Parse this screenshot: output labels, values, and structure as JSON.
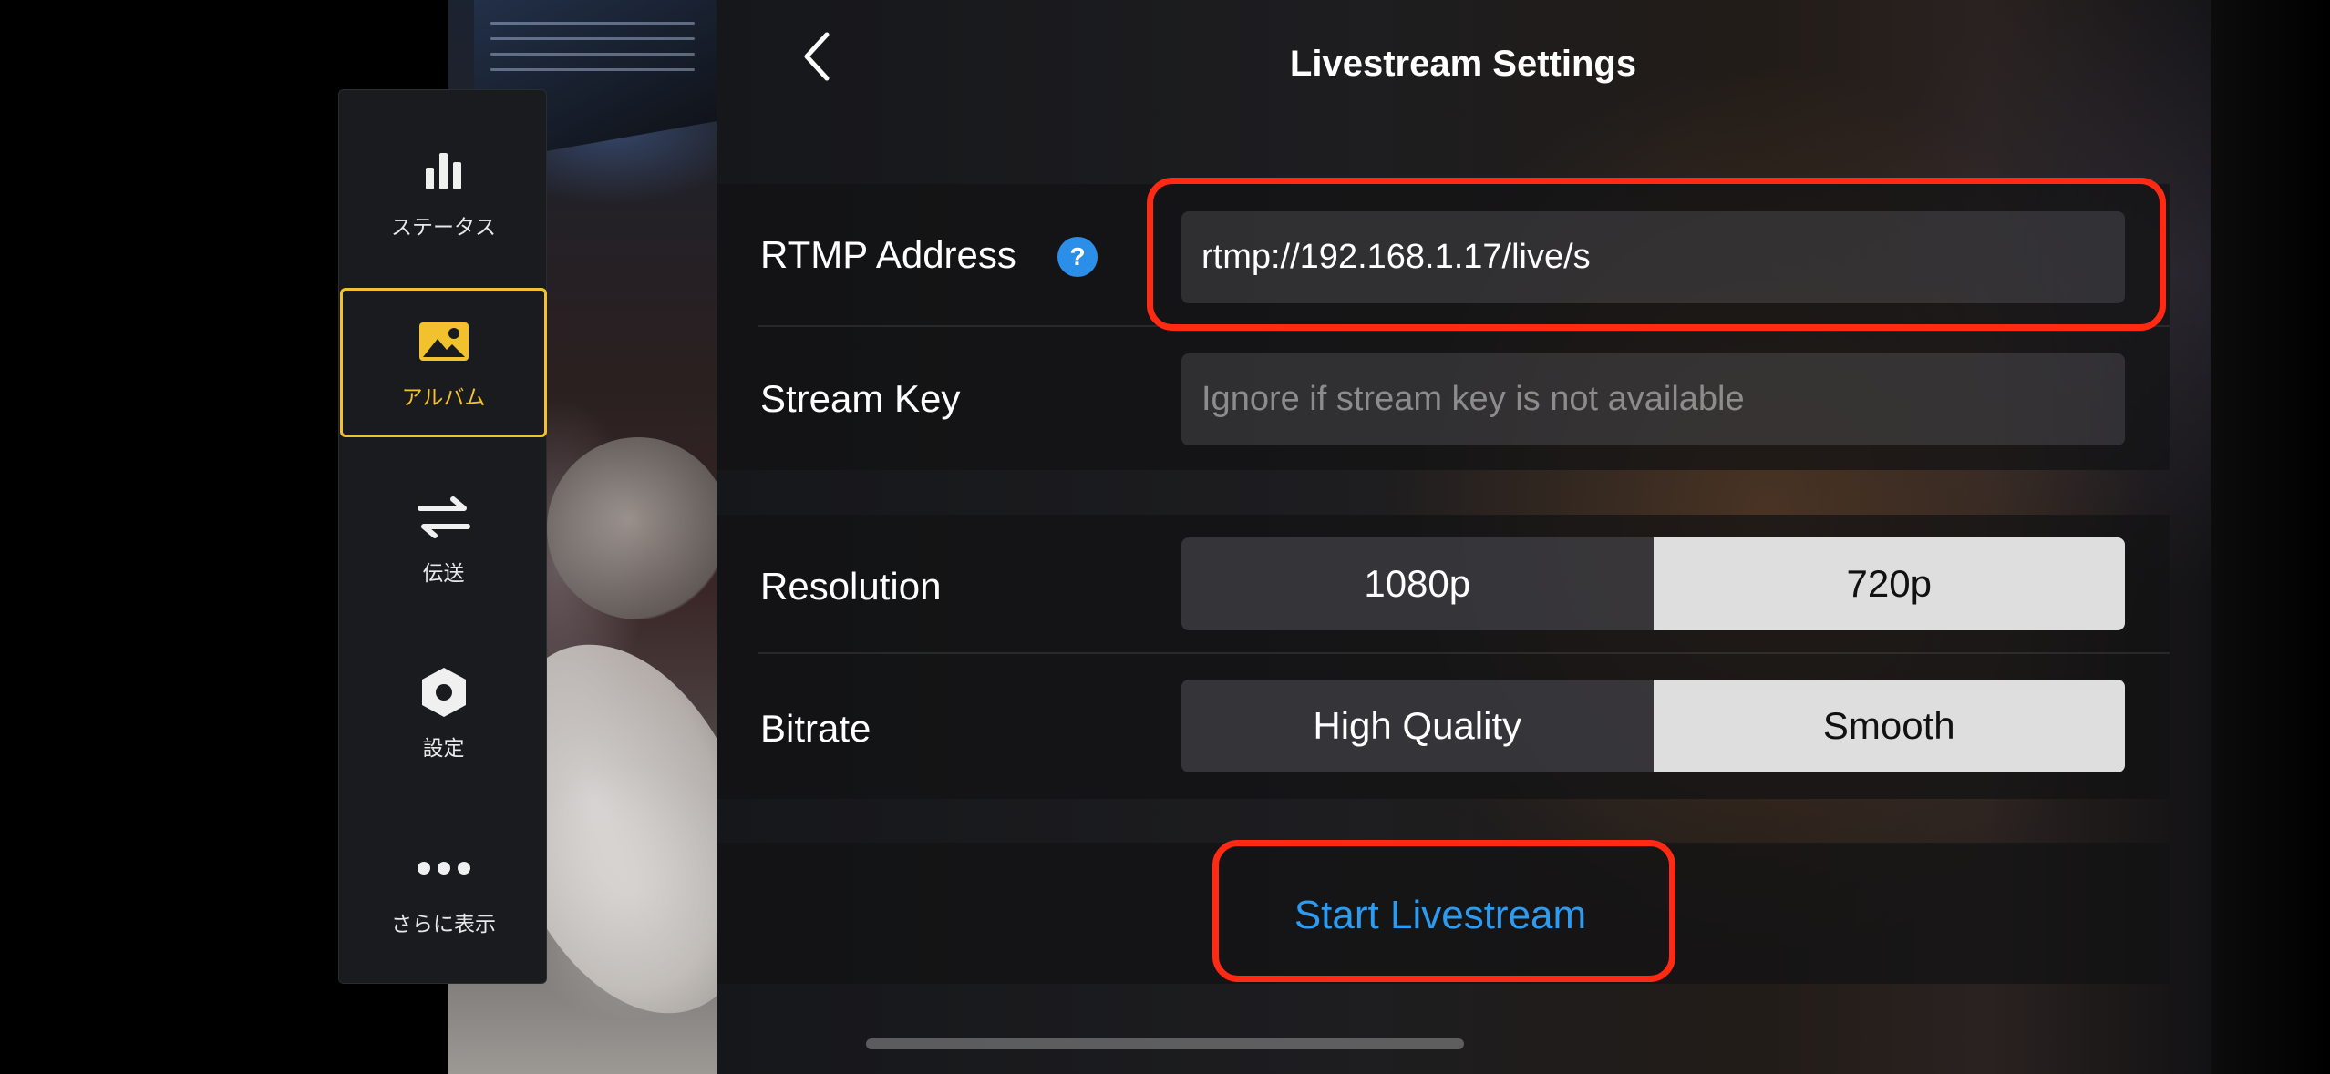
{
  "sidebar": {
    "items": [
      {
        "label": "ステータス",
        "icon": "bar-chart-icon"
      },
      {
        "label": "アルバム",
        "icon": "image-icon",
        "active": true
      },
      {
        "label": "伝送",
        "icon": "transfer-arrows-icon"
      },
      {
        "label": "設定",
        "icon": "settings-hex-icon"
      },
      {
        "label": "さらに表示",
        "icon": "more-dots-icon"
      }
    ],
    "active_color": "#f2c12e"
  },
  "header": {
    "title": "Livestream Settings",
    "back_icon": "chevron-left-icon"
  },
  "stream": {
    "rtmp_label": "RTMP Address",
    "rtmp_value": "rtmp://192.168.1.17/live/s",
    "help_icon": "?",
    "key_label": "Stream Key",
    "key_placeholder": "Ignore if stream key is not available"
  },
  "options": {
    "resolution_label": "Resolution",
    "resolution_options": [
      "1080p",
      "720p"
    ],
    "resolution_selected": "720p",
    "bitrate_label": "Bitrate",
    "bitrate_options": [
      "High Quality",
      "Smooth"
    ],
    "bitrate_selected": "Smooth"
  },
  "actions": {
    "start_label": "Start Livestream",
    "start_color": "#2d9bf0"
  },
  "highlight_color": "#ff2a14"
}
